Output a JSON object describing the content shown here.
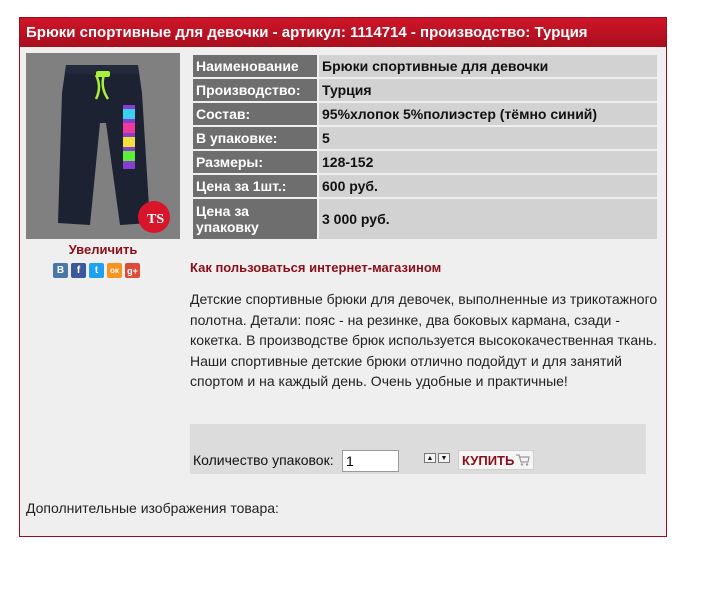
{
  "header": {
    "title": "Брюки спортивные для девочки - артикул: 1114714 - производство: Турция"
  },
  "product": {
    "zoom_label": "Увеличить",
    "photo_icon": "pants-photo",
    "brand_badge": "TS"
  },
  "social": {
    "icons": [
      "vk-icon",
      "facebook-icon",
      "twitter-icon",
      "odnoklassniki-icon",
      "googleplus-icon"
    ],
    "glyphs": [
      "В",
      "f",
      "t",
      "ок",
      "g+"
    ],
    "colors": [
      "#4a76a8",
      "#3b5998",
      "#1da1f2",
      "#f7931e",
      "#dd4b39"
    ]
  },
  "specs": [
    {
      "label": "Наименование",
      "value": "Брюки спортивные для девочки"
    },
    {
      "label": "Производство:",
      "value": "Турция"
    },
    {
      "label": "Состав:",
      "value": "95%хлопок 5%полиэстер (тёмно синий)"
    },
    {
      "label": "В упаковке:",
      "value": "5"
    },
    {
      "label": "Размеры:",
      "value": "128-152"
    },
    {
      "label": "Цена за 1шт.:",
      "value": "600 руб."
    },
    {
      "label": "Цена за упаковку",
      "value": "3 000 руб."
    }
  ],
  "howto_link": "Как пользоваться интернет-магазином",
  "description": "Детские спортивные  брюки для девочек, выполненные из трикотажного полотна. Детали: пояс - на резинке, два боковых кармана, сзади - кокетка. В производстве брюк используется высококачественная ткань. Наши спортивные детские брюки отлично подойдут и для занятий спортом и на каждый день. Очень удобные и практичные!",
  "order": {
    "qty_label": "Количество упаковок:",
    "qty_value": "1",
    "up_glyph": "▲",
    "down_glyph": "▼",
    "buy_label": "КУПИТЬ",
    "cart_icon": "cart-icon"
  },
  "extra_images_label": "Дополнительные изображения товара:",
  "colors": {
    "brand": "#b5101f",
    "link": "#8b0d1a",
    "key_cell": "#6e6e6e",
    "value_cell": "#d2d2d2"
  }
}
